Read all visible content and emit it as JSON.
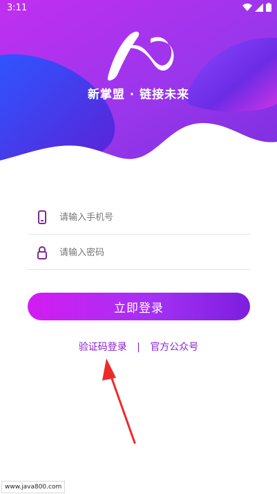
{
  "status_bar": {
    "time": "3:11"
  },
  "brand": {
    "slogan": "新掌盟 · 链接未来"
  },
  "form": {
    "phone_placeholder": "请输入手机号",
    "password_placeholder": "请输入密码",
    "login_label": "立即登录"
  },
  "links": {
    "sms_login": "验证码登录",
    "separator": "|",
    "official_account": "官方公众号"
  },
  "watermark": "www.java800.com",
  "colors": {
    "accent": "#8a1fd2",
    "button_start": "#d21cf2",
    "button_end": "#7d1ee0",
    "hero_start": "#b02cf0",
    "hero_end": "#6d2ed8"
  },
  "icons": [
    "wifi-icon",
    "signal-icon",
    "battery-icon",
    "phone-icon",
    "lock-icon"
  ]
}
